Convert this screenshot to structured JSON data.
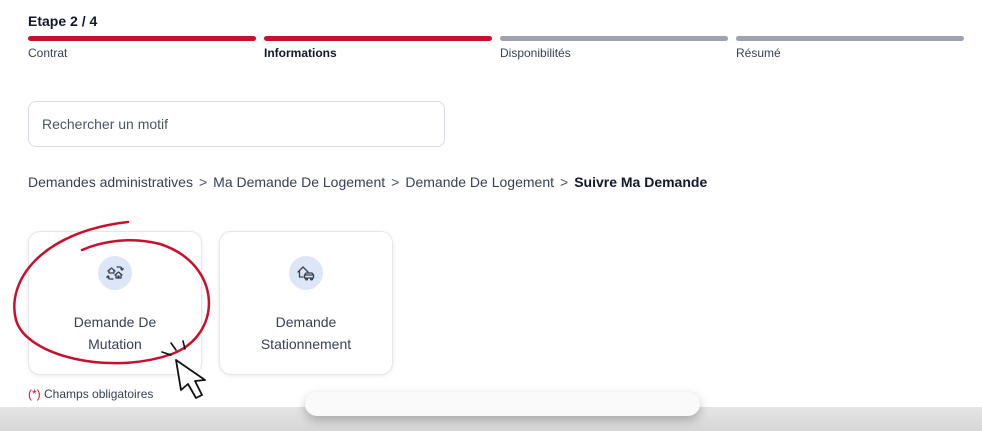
{
  "stepper": {
    "title": "Etape 2 / 4",
    "steps": [
      {
        "label": "Contrat",
        "status": "done"
      },
      {
        "label": "Informations",
        "status": "current"
      },
      {
        "label": "Disponibilités",
        "status": "todo"
      },
      {
        "label": "Résumé",
        "status": "todo"
      }
    ]
  },
  "search": {
    "placeholder": "Rechercher un motif"
  },
  "breadcrumb": {
    "separator": ">",
    "items": [
      "Demandes administratives",
      "Ma Demande De Logement",
      "Demande De Logement",
      "Suivre Ma Demande"
    ]
  },
  "cards": [
    {
      "label": "Demande De Mutation",
      "icon": "house-exchange-icon"
    },
    {
      "label": "Demande Stationnement",
      "icon": "house-car-icon"
    }
  ],
  "footer": {
    "required_star": "(*)",
    "required_text": " Champs obligatoires"
  },
  "colors": {
    "accent": "#c8102e",
    "inactive": "#9ca3af",
    "icon_bg": "#dde6f7",
    "icon_fg": "#374151"
  }
}
